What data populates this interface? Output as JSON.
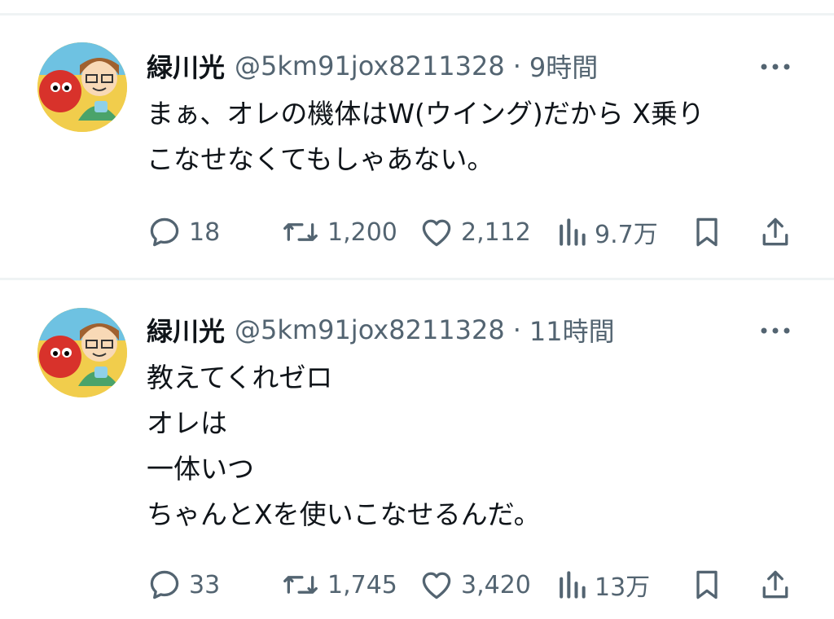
{
  "tweets": [
    {
      "author": {
        "name": "緑川光",
        "handle": "@5km91jox8211328"
      },
      "separator": "·",
      "time": "9時間",
      "text_lines": [
        "まぁ、オレの機体はW(ウイング)だから X乗り",
        "こなせなくてもしゃあない。"
      ],
      "stats": {
        "replies": "18",
        "retweets": "1,200",
        "likes": "2,112",
        "views": "9.7万"
      }
    },
    {
      "author": {
        "name": "緑川光",
        "handle": "@5km91jox8211328"
      },
      "separator": "·",
      "time": "11時間",
      "text_lines": [
        "教えてくれゼロ",
        "オレは",
        "一体いつ",
        "ちゃんとXを使いこなせるんだ。"
      ],
      "stats": {
        "replies": "33",
        "retweets": "1,745",
        "likes": "3,420",
        "views": "13万"
      }
    }
  ],
  "icons": {
    "more": "more-icon",
    "reply": "reply-icon",
    "retweet": "retweet-icon",
    "like": "heart-icon",
    "views": "views-icon",
    "bookmark": "bookmark-icon",
    "share": "share-icon"
  },
  "colors": {
    "text": "#0f1419",
    "secondary": "#536471",
    "divider": "#eff3f4"
  }
}
